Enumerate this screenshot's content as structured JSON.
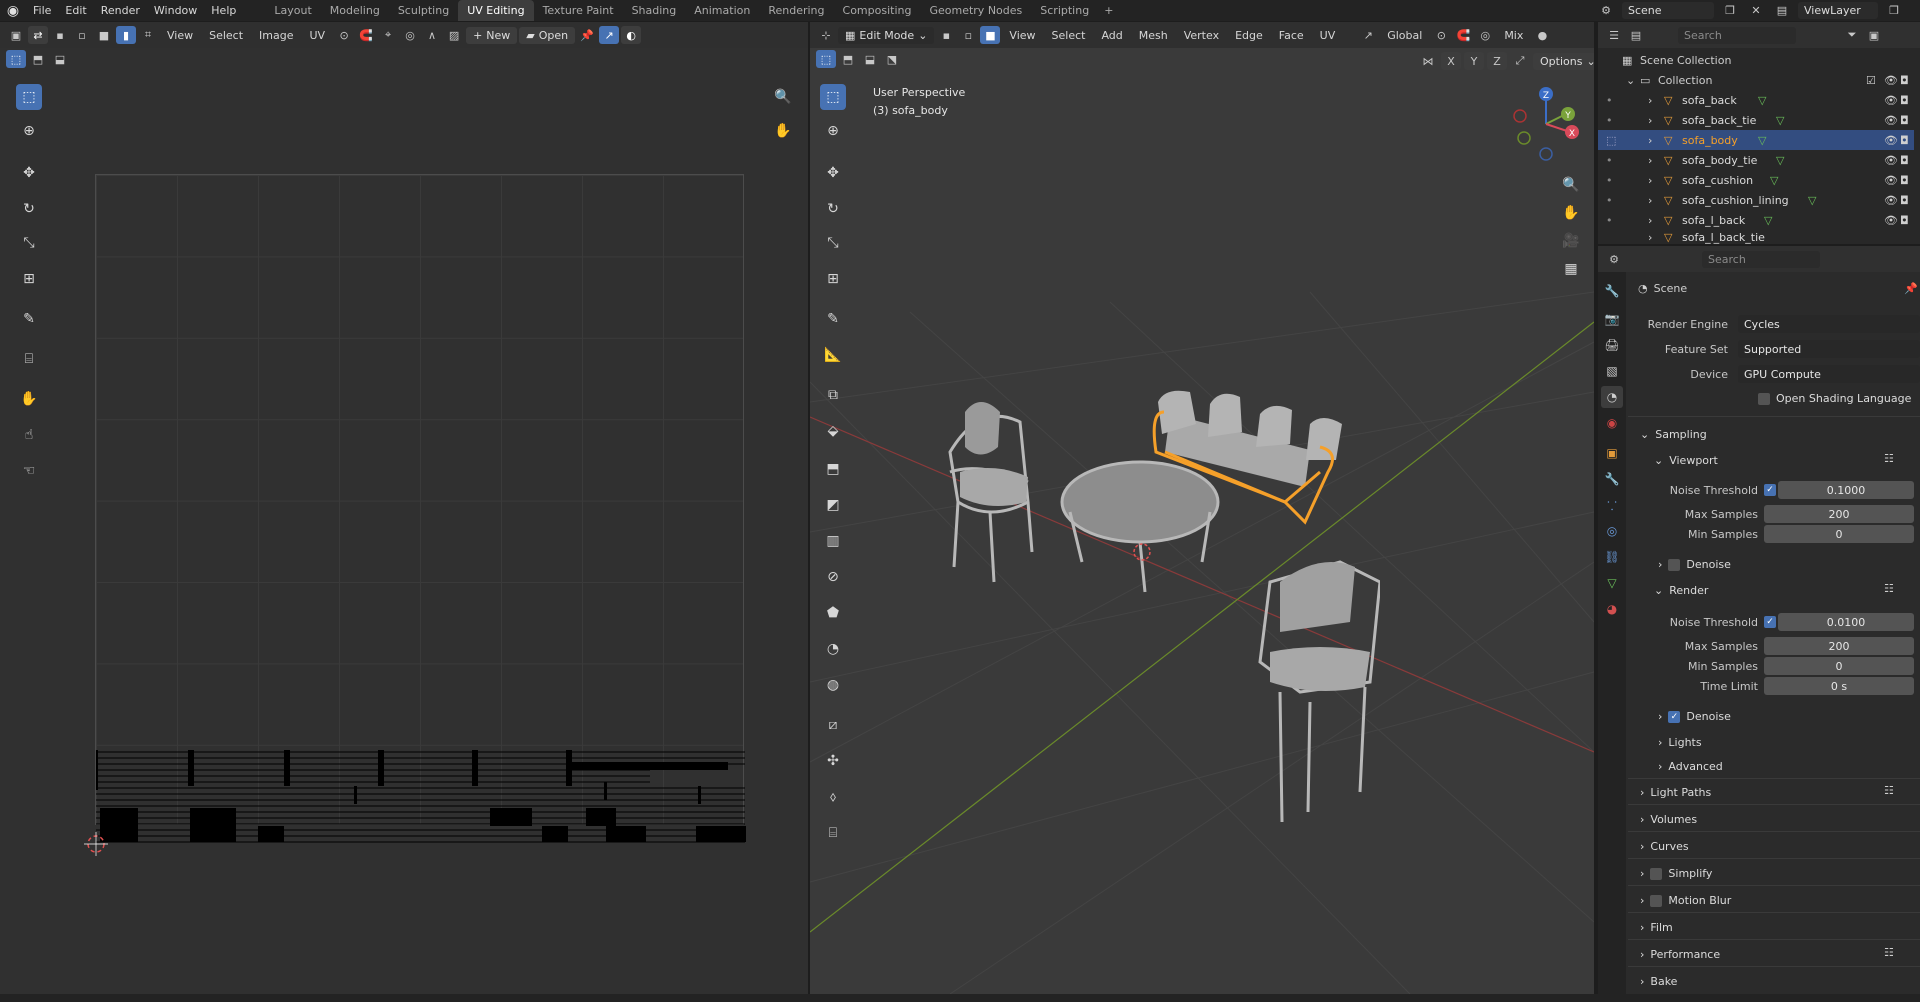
{
  "topbar": {
    "menus": [
      "File",
      "Edit",
      "Render",
      "Window",
      "Help"
    ],
    "workspaces": [
      "Layout",
      "Modeling",
      "Sculpting",
      "UV Editing",
      "Texture Paint",
      "Shading",
      "Animation",
      "Rendering",
      "Compositing",
      "Geometry Nodes",
      "Scripting"
    ],
    "active_workspace": "UV Editing",
    "scene": "Scene",
    "view_layer": "ViewLayer"
  },
  "uv_editor": {
    "menus": [
      "View",
      "Select",
      "Image",
      "UV"
    ],
    "new_label": "New",
    "open_label": "Open"
  },
  "viewport": {
    "mode": "Edit Mode",
    "menus": [
      "View",
      "Select",
      "Add",
      "Mesh",
      "Vertex",
      "Edge",
      "Face",
      "UV"
    ],
    "orientation": "Global",
    "shading_mix": "Mix",
    "options_label": "Options",
    "axes": [
      "X",
      "Y",
      "Z"
    ],
    "overlay_title": "User Perspective",
    "overlay_object": "(3) sofa_body",
    "gizmo": {
      "x": "X",
      "y": "Y",
      "z": "Z"
    }
  },
  "outliner": {
    "search_placeholder": "Search",
    "root": "Scene Collection",
    "collection": "Collection",
    "items": [
      {
        "name": "sofa_back",
        "selected": false
      },
      {
        "name": "sofa_back_tie",
        "selected": false
      },
      {
        "name": "sofa_body",
        "selected": true
      },
      {
        "name": "sofa_body_tie",
        "selected": false
      },
      {
        "name": "sofa_cushion",
        "selected": false
      },
      {
        "name": "sofa_cushion_lining",
        "selected": false
      },
      {
        "name": "sofa_l_back",
        "selected": false
      },
      {
        "name": "sofa_l_back_tie",
        "selected": false
      }
    ]
  },
  "properties": {
    "search_placeholder": "Search",
    "context": "Scene",
    "render_engine_label": "Render Engine",
    "render_engine": "Cycles",
    "feature_set_label": "Feature Set",
    "feature_set": "Supported",
    "device_label": "Device",
    "device": "GPU Compute",
    "osl_label": "Open Shading Language",
    "sampling": "Sampling",
    "viewport_panel": "Viewport",
    "render_panel": "Render",
    "noise_threshold_label": "Noise Threshold",
    "max_samples_label": "Max Samples",
    "min_samples_label": "Min Samples",
    "time_limit_label": "Time Limit",
    "denoise_label": "Denoise",
    "viewport_values": {
      "noise_threshold": "0.1000",
      "max_samples": "200",
      "min_samples": "0"
    },
    "render_values": {
      "noise_threshold": "0.0100",
      "max_samples": "200",
      "min_samples": "0",
      "time_limit": "0 s"
    },
    "subpanels": [
      "Lights",
      "Advanced"
    ],
    "panels": [
      "Light Paths",
      "Volumes",
      "Curves",
      "Simplify",
      "Motion Blur",
      "Film",
      "Performance",
      "Bake"
    ]
  },
  "colors": {
    "accent": "#4772b3",
    "selection_orange": "#f5a02a",
    "background": "#303030"
  }
}
